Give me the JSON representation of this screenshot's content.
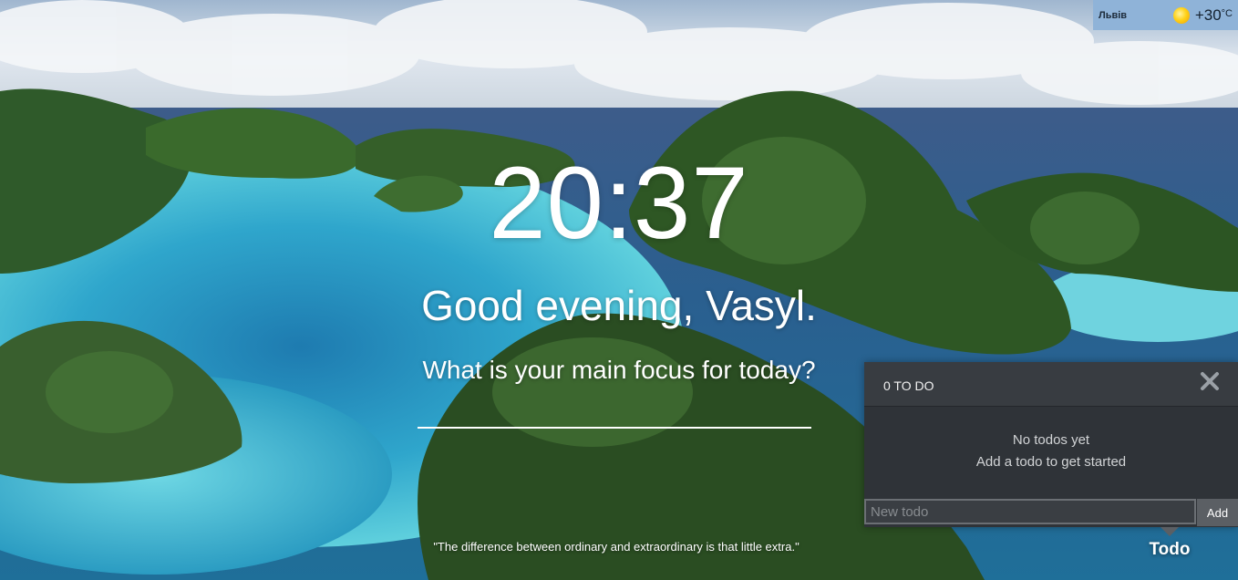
{
  "weather": {
    "city": "Львів",
    "icon": "sun-icon",
    "temperature": "+30",
    "unit": "°C"
  },
  "clock": {
    "time": "20:37"
  },
  "greeting": {
    "text": "Good evening, Vasyl."
  },
  "focus": {
    "question": "What is your main focus for today?",
    "value": ""
  },
  "quote": {
    "text": "\"The difference between ordinary and extraordinary is that little extra.\""
  },
  "todo": {
    "count_label": "0 TO DO",
    "close_icon": "close-icon",
    "empty_title": "No todos yet",
    "empty_subtitle": "Add a todo to get started",
    "input_placeholder": "New todo",
    "add_label": "Add",
    "toggle_label": "Todo"
  },
  "colors": {
    "panel_bg": "#2f3338",
    "panel_header": "#383c41",
    "weather_bg": "#8fb3d8",
    "add_button": "#5b5f64"
  }
}
